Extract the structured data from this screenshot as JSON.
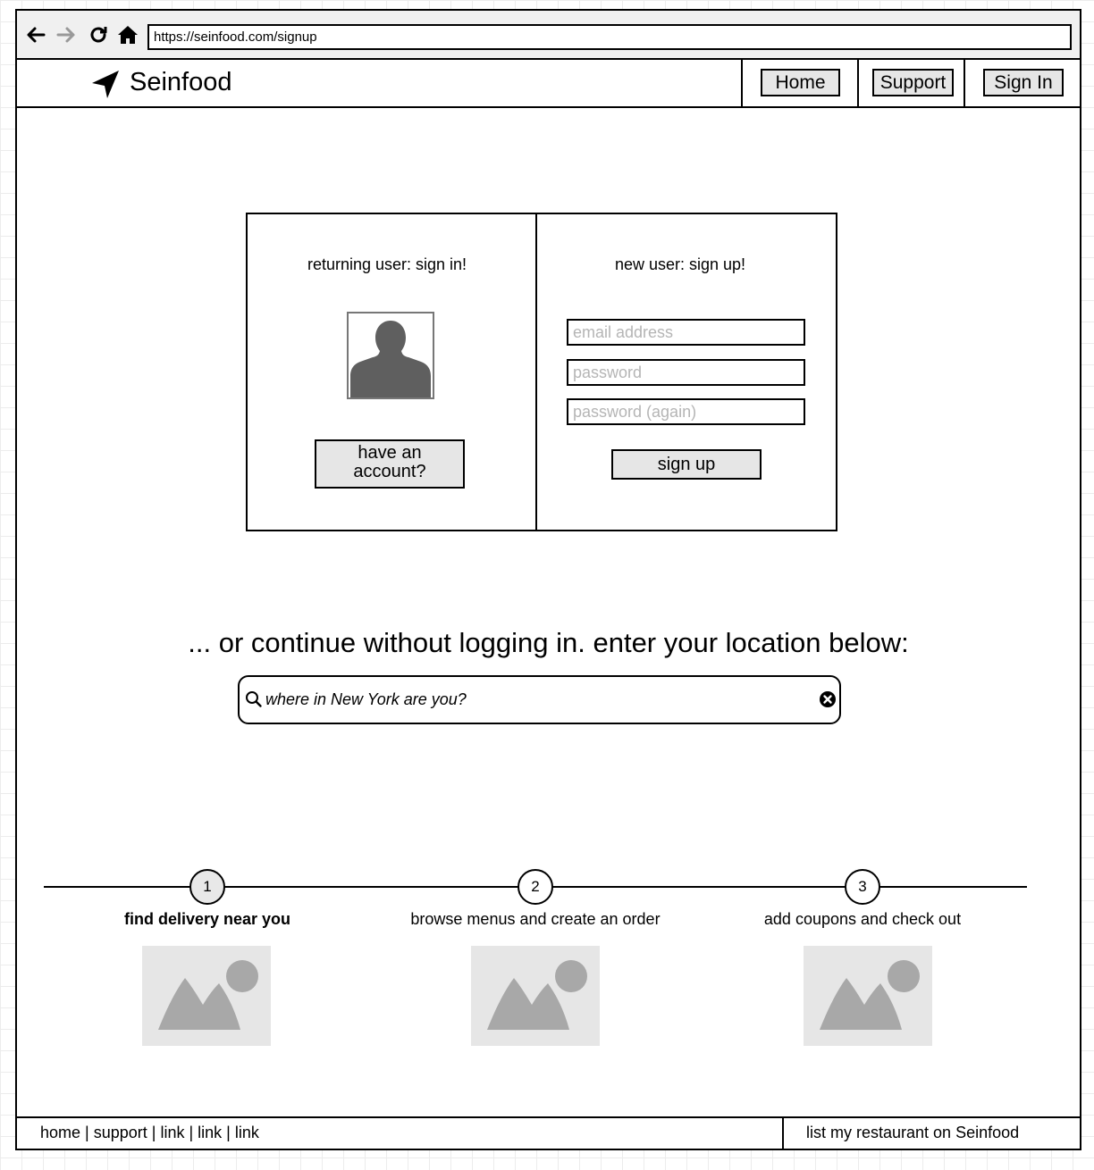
{
  "browser": {
    "url": "https://seinfood.com/signup",
    "icons": [
      "back-arrow-icon",
      "forward-arrow-icon",
      "reload-icon",
      "home-icon"
    ]
  },
  "header": {
    "brand": "Seinfood",
    "brand_icon": "location-arrow-icon",
    "nav": [
      "Home",
      "Support",
      "Sign In"
    ]
  },
  "login": {
    "returning_heading": "returning user: sign in!",
    "avatar_icon": "user-avatar-icon",
    "have_account_line1": "have an",
    "have_account_line2": "account?",
    "new_heading": "new user: sign up!",
    "email_placeholder": "email address",
    "password_placeholder": "password",
    "password_again_placeholder": "password (again)",
    "signup_label": "sign up"
  },
  "location": {
    "prompt": "... or continue without logging in. enter your location below:",
    "placeholder": "where in New York are you?",
    "search_icon": "search-icon",
    "clear_icon": "clear-icon"
  },
  "steps": [
    {
      "number": "1",
      "label": "find delivery near you",
      "active": true
    },
    {
      "number": "2",
      "label": "browse menus and create an order",
      "active": false
    },
    {
      "number": "3",
      "label": "add coupons and check out",
      "active": false
    }
  ],
  "footer": {
    "links": [
      "home",
      "support",
      "link",
      "link",
      "link"
    ],
    "separator": " | ",
    "list_restaurant": "list my restaurant on Seinfood"
  }
}
